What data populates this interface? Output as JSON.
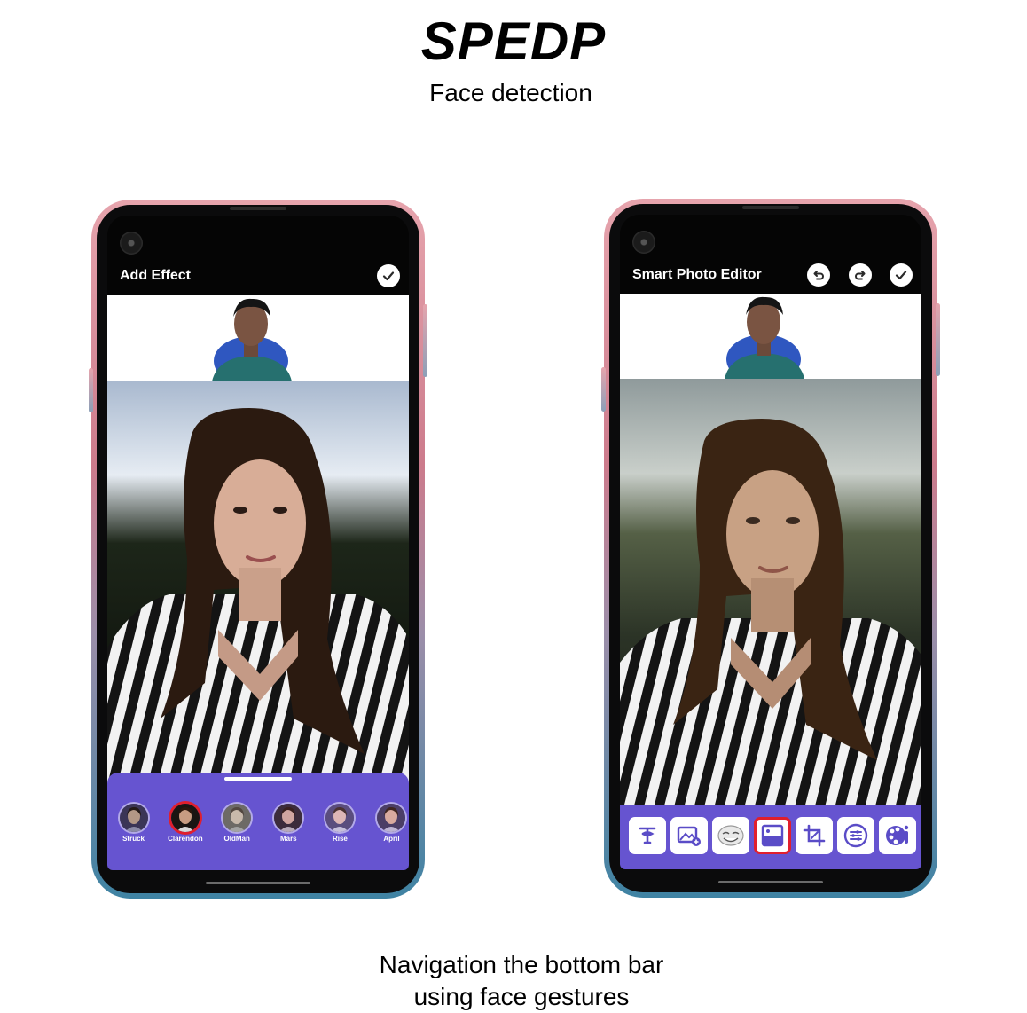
{
  "header": {
    "title": "SPEDP",
    "subtitle": "Face detection"
  },
  "caption": {
    "line1": "Navigation the bottom bar",
    "line2": "using face gestures"
  },
  "phones": {
    "left": {
      "app_title": "Add Effect",
      "actions": [
        "check-icon"
      ],
      "effects": [
        {
          "label": "Struck",
          "selected": false
        },
        {
          "label": "Clarendon",
          "selected": true
        },
        {
          "label": "OldMan",
          "selected": false
        },
        {
          "label": "Mars",
          "selected": false
        },
        {
          "label": "Rise",
          "selected": false
        },
        {
          "label": "April",
          "selected": false
        }
      ]
    },
    "right": {
      "app_title": "Smart Photo Editor",
      "actions": [
        "undo-icon",
        "redo-icon",
        "check-icon"
      ],
      "tools": [
        {
          "icon": "text-icon",
          "selected": false
        },
        {
          "icon": "add-image-icon",
          "selected": false
        },
        {
          "icon": "sticker-icon",
          "selected": false
        },
        {
          "icon": "filter-icon",
          "selected": true
        },
        {
          "icon": "crop-icon",
          "selected": false
        },
        {
          "icon": "adjust-icon",
          "selected": false
        },
        {
          "icon": "effects-palette-icon",
          "selected": false
        }
      ]
    }
  },
  "colors": {
    "accent": "#6654d0",
    "selection": "#e01f2d"
  }
}
